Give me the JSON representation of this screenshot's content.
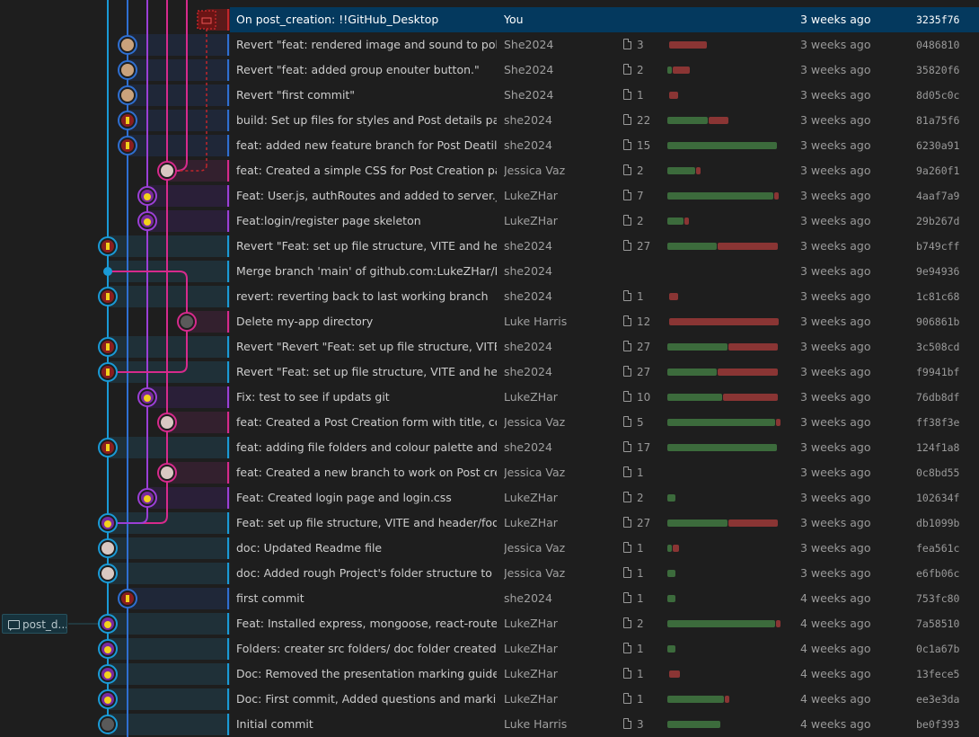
{
  "colors": {
    "cyan": "#1a9ad6",
    "blue": "#2f6fd1",
    "purple": "#9b3fd6",
    "magenta": "#d62a8c",
    "red": "#c0262b",
    "selected": "#04395e",
    "additions": "#3c6b3c",
    "deletions": "#8a3534"
  },
  "branch_tag": {
    "label": "post_d...",
    "icon": "ticket-icon"
  },
  "commits": [
    {
      "message": "On post_creation: !!GitHub_Desktop",
      "author": "You",
      "files": "",
      "add": 0,
      "del": 0,
      "date": "3 weeks ago",
      "sha": "3235f76",
      "lane": "stash",
      "avatar": "stash-icon",
      "selected": true
    },
    {
      "message": "Revert \"feat: rendered image and sound to pokemon ap",
      "author": "She2024",
      "files": "3",
      "add": 0,
      "del": 0.33,
      "date": "3 weeks ago",
      "sha": "0486810",
      "lane": "blue",
      "avatar": "avatar-she-photo"
    },
    {
      "message": "Revert \"feat: added group enouter button.\"",
      "author": "She2024",
      "files": "2",
      "add": 0.04,
      "del": 0.15,
      "date": "3 weeks ago",
      "sha": "35820f6",
      "lane": "blue",
      "avatar": "avatar-she-photo"
    },
    {
      "message": "Revert \"first commit\"",
      "author": "She2024",
      "files": "1",
      "add": 0,
      "del": 0.08,
      "date": "3 weeks ago",
      "sha": "8d05c0c",
      "lane": "blue",
      "avatar": "avatar-she-photo"
    },
    {
      "message": "build: Set up files for styles and Post details page. Work",
      "author": "she2024",
      "files": "22",
      "add": 0.35,
      "del": 0.17,
      "date": "3 weeks ago",
      "sha": "81a75f6",
      "lane": "blue",
      "avatar": "avatar-she-pixel"
    },
    {
      "message": "feat: added new feature branch for Post Deatils page.",
      "author": "she2024",
      "files": "15",
      "add": 0.95,
      "del": 0,
      "date": "3 weeks ago",
      "sha": "6230a91",
      "lane": "blue",
      "avatar": "avatar-she-pixel"
    },
    {
      "message": "feat: Created a simple CSS for Post Creation page",
      "author": "Jessica Vaz",
      "files": "2",
      "add": 0.24,
      "del": 0.04,
      "date": "3 weeks ago",
      "sha": "9a260f1",
      "lane": "magenta",
      "avatar": "avatar-jessica"
    },
    {
      "message": "Feat: User.js, authRoutes and added to server.js",
      "author": "LukeZHar",
      "files": "7",
      "add": 0.92,
      "del": 0.04,
      "date": "3 weeks ago",
      "sha": "4aaf7a9",
      "lane": "purple",
      "avatar": "avatar-lukezhar"
    },
    {
      "message": "Feat:login/register page skeleton",
      "author": "LukeZHar",
      "files": "2",
      "add": 0.14,
      "del": 0.04,
      "date": "3 weeks ago",
      "sha": "29b267d",
      "lane": "purple",
      "avatar": "avatar-lukezhar"
    },
    {
      "message": "Revert \"Feat: set up file structure, VITE and header/foote",
      "author": "she2024",
      "files": "27",
      "add": 0.43,
      "del": 0.52,
      "date": "3 weeks ago",
      "sha": "b749cff",
      "lane": "cyan",
      "avatar": "avatar-she-pixel"
    },
    {
      "message": "Merge branch 'main' of github.com:LukeZHar/MERN-\\",
      "author": "she2024",
      "files": "",
      "add": 0,
      "del": 0,
      "date": "3 weeks ago",
      "sha": "9e94936",
      "lane": "cyan",
      "avatar": "merge-dot"
    },
    {
      "message": "revert: reverting back to last working branch",
      "author": "she2024",
      "files": "1",
      "add": 0,
      "del": 0.08,
      "date": "3 weeks ago",
      "sha": "1c81c68",
      "lane": "cyan",
      "avatar": "avatar-she-pixel"
    },
    {
      "message": "Delete my-app directory",
      "author": "Luke Harris",
      "files": "12",
      "add": 0,
      "del": 0.95,
      "date": "3 weeks ago",
      "sha": "906861b",
      "lane": "crimson",
      "avatar": "avatar-luke-harris"
    },
    {
      "message": "Revert \"Revert \"Feat: set up file structure, VITE and heac",
      "author": "she2024",
      "files": "27",
      "add": 0.52,
      "del": 0.43,
      "date": "3 weeks ago",
      "sha": "3c508cd",
      "lane": "cyan",
      "avatar": "avatar-she-pixel"
    },
    {
      "message": "Revert \"Feat: set up file structure, VITE and header/foote",
      "author": "she2024",
      "files": "27",
      "add": 0.43,
      "del": 0.52,
      "date": "3 weeks ago",
      "sha": "f9941bf",
      "lane": "cyan",
      "avatar": "avatar-she-pixel"
    },
    {
      "message": "Fix: test to see if updats git",
      "author": "LukeZHar",
      "files": "10",
      "add": 0.48,
      "del": 0.47,
      "date": "3 weeks ago",
      "sha": "76db8df",
      "lane": "purple",
      "avatar": "avatar-lukezhar"
    },
    {
      "message": "feat: Created a Post Creation form with title, content, pi",
      "author": "Jessica Vaz",
      "files": "5",
      "add": 0.94,
      "del": 0.04,
      "date": "3 weeks ago",
      "sha": "ff38f3e",
      "lane": "magenta",
      "avatar": "avatar-jessica"
    },
    {
      "message": "feat: adding file folders and colour palette and prep wo",
      "author": "she2024",
      "files": "17",
      "add": 0.95,
      "del": 0,
      "date": "3 weeks ago",
      "sha": "124f1a8",
      "lane": "cyan",
      "avatar": "avatar-she-pixel"
    },
    {
      "message": "feat: Created a new branch to work on Post creation pa",
      "author": "Jessica Vaz",
      "files": "1",
      "add": 0,
      "del": 0,
      "date": "3 weeks ago",
      "sha": "0c8bd55",
      "lane": "magenta",
      "avatar": "avatar-jessica"
    },
    {
      "message": "Feat: Created login page and login.css",
      "author": "LukeZHar",
      "files": "2",
      "add": 0.07,
      "del": 0,
      "date": "3 weeks ago",
      "sha": "102634f",
      "lane": "purple",
      "avatar": "avatar-lukezhar"
    },
    {
      "message": "Feat: set up file structure, VITE and header/footer featur",
      "author": "LukeZHar",
      "files": "27",
      "add": 0.52,
      "del": 0.43,
      "date": "3 weeks ago",
      "sha": "db1099b",
      "lane": "cyan",
      "avatar": "avatar-lukezhar"
    },
    {
      "message": "doc: Updated Readme file",
      "author": "Jessica Vaz",
      "files": "1",
      "add": 0.04,
      "del": 0.05,
      "date": "3 weeks ago",
      "sha": "fea561c",
      "lane": "cyan",
      "avatar": "avatar-jessica"
    },
    {
      "message": "doc: Added rough Project's folder structure to Readme",
      "author": "Jessica Vaz",
      "files": "1",
      "add": 0.07,
      "del": 0,
      "date": "3 weeks ago",
      "sha": "e6fb06c",
      "lane": "cyan",
      "avatar": "avatar-jessica"
    },
    {
      "message": "first commit",
      "author": "she2024",
      "files": "1",
      "add": 0.07,
      "del": 0,
      "date": "4 weeks ago",
      "sha": "753fc80",
      "lane": "blue",
      "avatar": "avatar-she-pixel"
    },
    {
      "message": "Feat: Installed express, mongoose, react-router-dom an",
      "author": "LukeZHar",
      "files": "2",
      "add": 0.94,
      "del": 0.04,
      "date": "4 weeks ago",
      "sha": "7a58510",
      "lane": "cyan",
      "avatar": "avatar-lukezhar"
    },
    {
      "message": "Folders: creater src folders/ doc folder created package.",
      "author": "LukeZHar",
      "files": "1",
      "add": 0.07,
      "del": 0,
      "date": "4 weeks ago",
      "sha": "0c1a67b",
      "lane": "cyan",
      "avatar": "avatar-lukezhar"
    },
    {
      "message": "Doc: Removed the presentation marking guide",
      "author": "LukeZHar",
      "files": "1",
      "add": 0,
      "del": 0.09,
      "date": "4 weeks ago",
      "sha": "13fece5",
      "lane": "cyan",
      "avatar": "avatar-lukezhar"
    },
    {
      "message": "Doc: First commit, Added questions and marking guide",
      "author": "LukeZHar",
      "files": "1",
      "add": 0.49,
      "del": 0.04,
      "date": "4 weeks ago",
      "sha": "ee3e3da",
      "lane": "cyan",
      "avatar": "avatar-lukezhar"
    },
    {
      "message": "Initial commit",
      "author": "Luke Harris",
      "files": "3",
      "add": 0.46,
      "del": 0,
      "date": "4 weeks ago",
      "sha": "be0f393",
      "lane": "cyan",
      "avatar": "avatar-luke-harris"
    }
  ]
}
